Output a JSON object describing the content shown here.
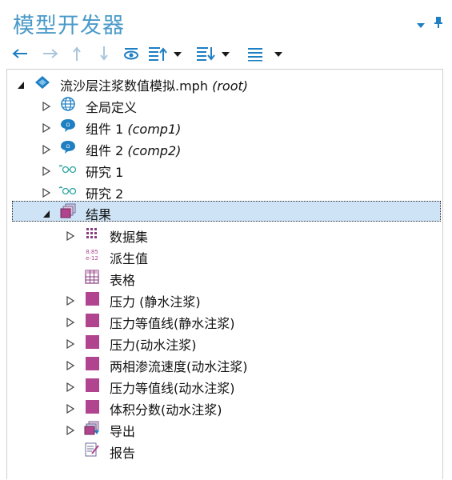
{
  "window": {
    "title": "模型开发器"
  },
  "colors": {
    "title": "#4a9ac9",
    "selection": "#cfe3f7",
    "plot_group": "#b1448f",
    "accent": "#1e7fc2"
  },
  "toolbar": {
    "buttons": [
      {
        "name": "back-arrow-icon",
        "glyph": "←"
      },
      {
        "name": "forward-arrow-icon",
        "glyph": "→"
      },
      {
        "name": "move-up-icon",
        "glyph": "↑"
      },
      {
        "name": "move-down-icon",
        "glyph": "↓"
      },
      {
        "name": "show-icon"
      },
      {
        "name": "collapse-all-icon"
      },
      {
        "name": "expand-all-icon"
      },
      {
        "name": "list-options-icon"
      }
    ]
  },
  "tree": {
    "root": {
      "label": "流沙层注浆数值模拟.mph",
      "tag": "(root)"
    },
    "global_defs": {
      "label": "全局定义"
    },
    "comp1": {
      "label": "组件 1",
      "tag": "(comp1)"
    },
    "comp2": {
      "label": "组件 2",
      "tag": "(comp2)"
    },
    "study1": {
      "label": "研究 1"
    },
    "study2": {
      "label": "研究 2"
    },
    "results": {
      "label": "结果"
    },
    "datasets": {
      "label": "数据集"
    },
    "derived_values": {
      "label": "派生值",
      "icon_text_top": "8.85",
      "icon_text_bottom": "e-12"
    },
    "tables": {
      "label": "表格"
    },
    "plot1": {
      "label": "压力 (静水注浆)"
    },
    "plot2": {
      "label": "压力等值线(静水注浆)"
    },
    "plot3": {
      "label": "压力(动水注浆)"
    },
    "plot4": {
      "label": "两相渗流速度(动水注浆)"
    },
    "plot5": {
      "label": "压力等值线(动水注浆)"
    },
    "plot6": {
      "label": "体积分数(动水注浆)"
    },
    "export": {
      "label": "导出"
    },
    "reports": {
      "label": "报告"
    }
  }
}
